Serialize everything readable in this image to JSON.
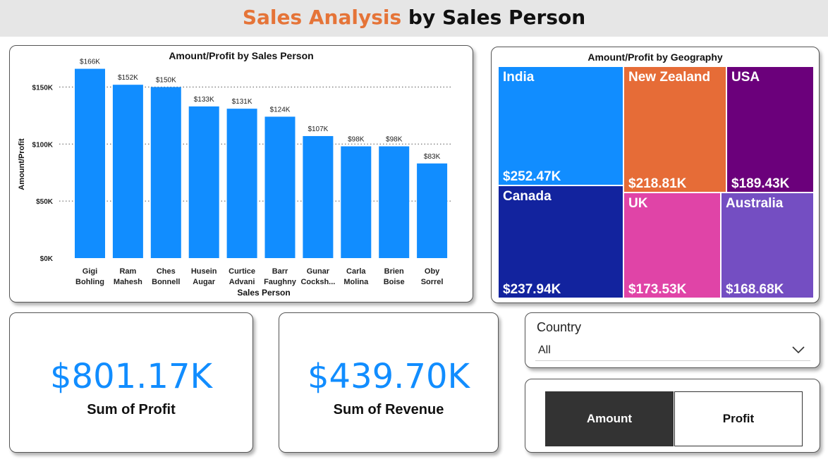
{
  "header": {
    "title_accent": "Sales Analysis",
    "title_rest": " by Sales Person",
    "accent_color": "#e57438"
  },
  "bar_chart": {
    "title": "Amount/Profit by Sales Person",
    "color": "#118dff"
  },
  "chart_data": [
    {
      "type": "bar",
      "title": "Amount/Profit by Sales Person",
      "xlabel": "Sales Person",
      "ylabel": "Amount/Profit",
      "categories": [
        [
          "Gigi",
          "Bohling"
        ],
        [
          "Ram",
          "Mahesh"
        ],
        [
          "Ches",
          "Bonnell"
        ],
        [
          "Husein",
          "Augar"
        ],
        [
          "Curtice",
          "Advani"
        ],
        [
          "Barr",
          "Faughny"
        ],
        [
          "Gunar",
          "Cocksh..."
        ],
        [
          "Carla",
          "Molina"
        ],
        [
          "Brien",
          "Boise"
        ],
        [
          "Oby",
          "Sorrel"
        ]
      ],
      "values": [
        166,
        152,
        150,
        133,
        131,
        124,
        107,
        98,
        98,
        83
      ],
      "data_labels": [
        "$166K",
        "$152K",
        "$150K",
        "$133K",
        "$131K",
        "$124K",
        "$107K",
        "$98K",
        "$98K",
        "$83K"
      ],
      "y_ticks": [
        0,
        50,
        100,
        150
      ],
      "y_tick_labels": [
        "$0K",
        "$50K",
        "$100K",
        "$150K"
      ],
      "ylim": [
        0,
        175
      ],
      "grid": true
    },
    {
      "type": "treemap",
      "title": "Amount/Profit by Geography",
      "items": [
        {
          "name": "India",
          "value": "$252.47K",
          "color": "#118dff"
        },
        {
          "name": "New Zealand",
          "value": "$218.81K",
          "color": "#e66c37"
        },
        {
          "name": "USA",
          "value": "$189.43K",
          "color": "#6b007b"
        },
        {
          "name": "Canada",
          "value": "$237.94K",
          "color": "#12239e"
        },
        {
          "name": "UK",
          "value": "$173.53K",
          "color": "#e044a7"
        },
        {
          "name": "Australia",
          "value": "$168.68K",
          "color": "#744ec2"
        }
      ]
    }
  ],
  "treemap": {
    "title": "Amount/Profit by Geography"
  },
  "kpis": [
    {
      "value": "$801.17K",
      "label": "Sum of Profit"
    },
    {
      "value": "$439.70K",
      "label": "Sum of Revenue"
    }
  ],
  "slicer": {
    "label": "Country",
    "value": "All",
    "icon": "chevron-down-icon"
  },
  "toggle": {
    "buttons": [
      {
        "label": "Amount",
        "active": true
      },
      {
        "label": "Profit",
        "active": false
      }
    ]
  }
}
